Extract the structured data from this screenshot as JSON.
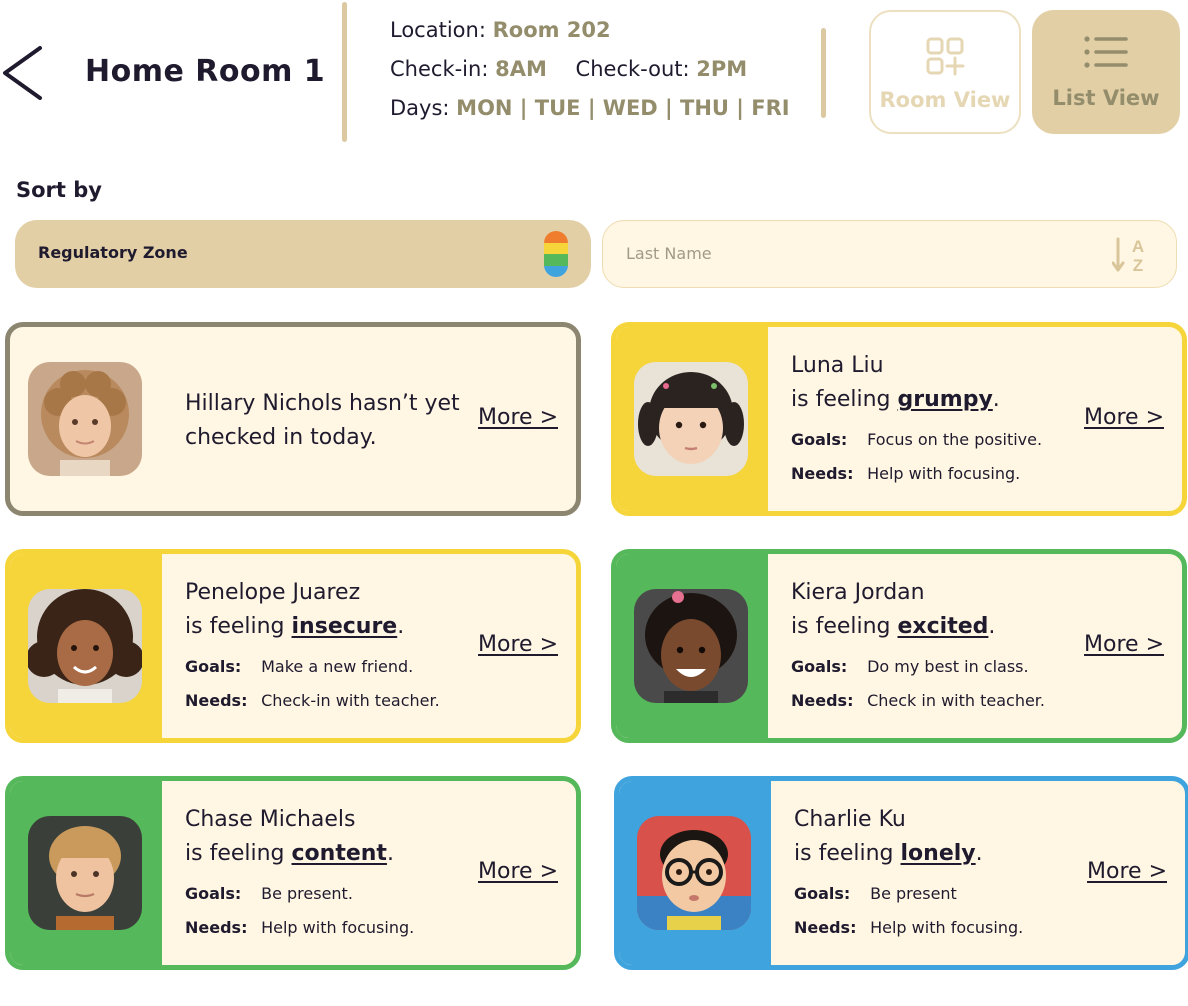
{
  "header": {
    "title": "Home Room 1",
    "location_label": "Location:",
    "location_value": "Room 202",
    "checkin_label": "Check-in:",
    "checkin_value": "8AM",
    "checkout_label": "Check-out:",
    "checkout_value": "2PM",
    "days_label": "Days:",
    "days_value": "MON | TUE | WED | THU | FRI",
    "room_view_label": "Room View",
    "list_view_label": "List View"
  },
  "sort": {
    "label": "Sort by",
    "zone_label": "Regulatory Zone",
    "name_label": "Last Name",
    "zone_colors": [
      "#ef7d2d",
      "#f5d53a",
      "#55b85a",
      "#3fa3dd"
    ]
  },
  "colors": {
    "accent_tan": "#e2cfa6",
    "accent_text": "#948d6c",
    "card_bg": "#fff7e3",
    "zone_yellow": "#f5d53a",
    "zone_green": "#55b85a",
    "zone_blue": "#3fa3dd",
    "zone_none": "#8c8670"
  },
  "students": [
    {
      "name": "Hillary Nichols",
      "message": "Hillary Nichols hasn’t yet checked in today.",
      "more": "More >",
      "zone_color": "#8c8670",
      "checked_in": false
    },
    {
      "name": "Luna Liu",
      "feeling_prefix": "is feeling ",
      "feeling": "grumpy",
      "feeling_suffix": ".",
      "goals_label": "Goals:",
      "goals": "Focus on the positive.",
      "needs_label": "Needs:",
      "needs": "Help with focusing.",
      "more": "More >",
      "zone_color": "#f5d53a"
    },
    {
      "name": "Penelope Juarez",
      "feeling_prefix": "is feeling ",
      "feeling": "insecure",
      "feeling_suffix": ".",
      "goals_label": "Goals:",
      "goals": "Make a new friend.",
      "needs_label": "Needs:",
      "needs": "Check-in with teacher.",
      "more": "More >",
      "zone_color": "#f5d53a"
    },
    {
      "name": "Kiera Jordan",
      "feeling_prefix": "is feeling ",
      "feeling": "excited",
      "feeling_suffix": ".",
      "goals_label": "Goals:",
      "goals": "Do my best in class.",
      "needs_label": "Needs:",
      "needs": "Check in with teacher.",
      "more": "More >",
      "zone_color": "#55b85a"
    },
    {
      "name": "Chase Michaels",
      "feeling_prefix": "is feeling ",
      "feeling": "content",
      "feeling_suffix": ".",
      "goals_label": "Goals:",
      "goals": "Be present.",
      "needs_label": "Needs:",
      "needs": "Help with focusing.",
      "more": "More >",
      "zone_color": "#55b85a"
    },
    {
      "name": "Charlie Ku",
      "feeling_prefix": "is feeling ",
      "feeling": "lonely",
      "feeling_suffix": ".",
      "goals_label": "Goals:",
      "goals": "Be present",
      "needs_label": "Needs:",
      "needs": "Help with focusing.",
      "more": "More >",
      "zone_color": "#3fa3dd"
    }
  ]
}
